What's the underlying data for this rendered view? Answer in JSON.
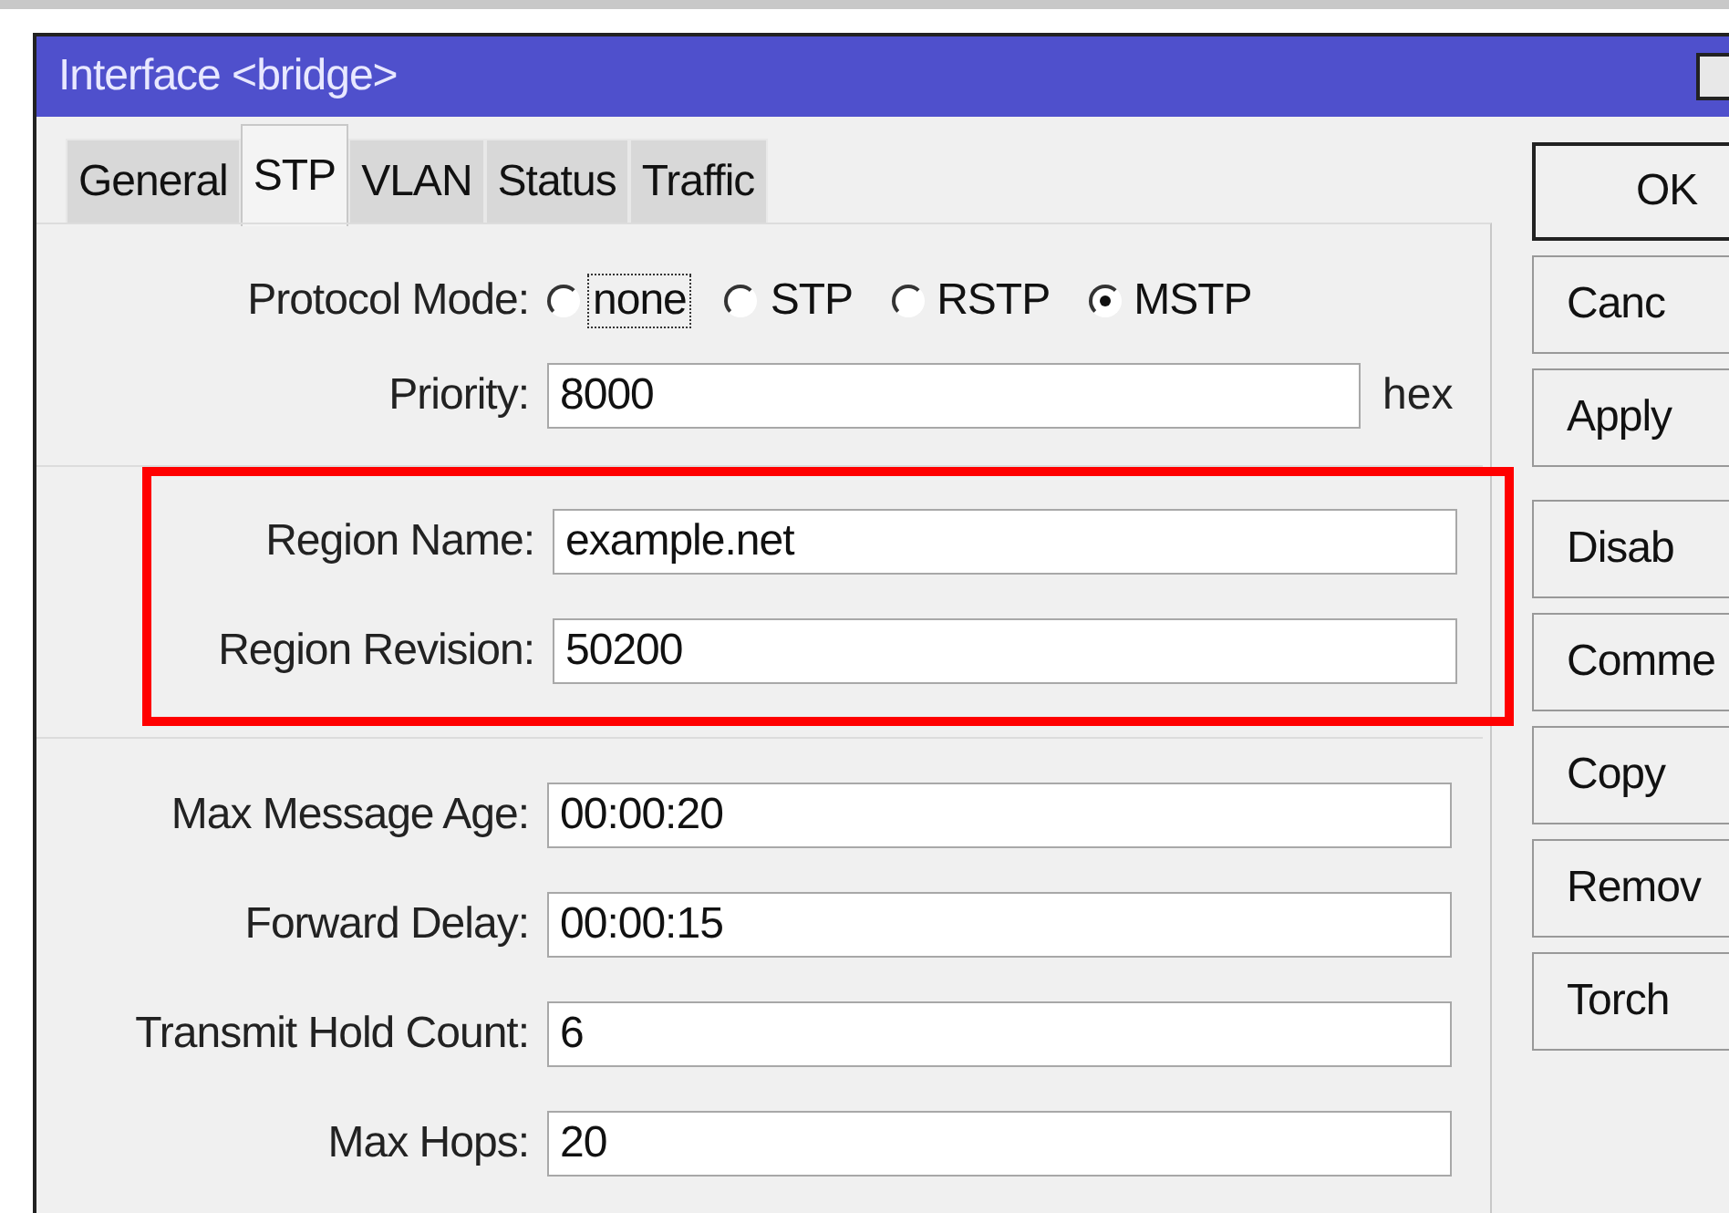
{
  "window": {
    "title": "Interface <bridge>"
  },
  "tabs": [
    {
      "label": "General",
      "selected": false
    },
    {
      "label": "STP",
      "selected": true
    },
    {
      "label": "VLAN",
      "selected": false
    },
    {
      "label": "Status",
      "selected": false
    },
    {
      "label": "Traffic",
      "selected": false
    }
  ],
  "protocol_mode": {
    "label": "Protocol Mode:",
    "options": [
      {
        "label": "none",
        "selected": false,
        "focused": true
      },
      {
        "label": "STP",
        "selected": false,
        "focused": false
      },
      {
        "label": "RSTP",
        "selected": false,
        "focused": false
      },
      {
        "label": "MSTP",
        "selected": true,
        "focused": false
      }
    ]
  },
  "priority": {
    "label": "Priority:",
    "value": "8000",
    "unit": "hex"
  },
  "region_fields": [
    {
      "label": "Region Name:",
      "value": "example.net"
    },
    {
      "label": "Region Revision:",
      "value": "50200"
    }
  ],
  "timing_fields": [
    {
      "label": "Max Message Age:",
      "value": "00:00:20"
    },
    {
      "label": "Forward Delay:",
      "value": "00:00:15"
    },
    {
      "label": "Transmit Hold Count:",
      "value": "6"
    },
    {
      "label": "Max Hops:",
      "value": "20"
    }
  ],
  "buttons": [
    [
      "OK",
      "Canc",
      "Apply"
    ],
    [
      "Disab",
      "Comme",
      "Copy",
      "Remov",
      "Torch"
    ]
  ]
}
